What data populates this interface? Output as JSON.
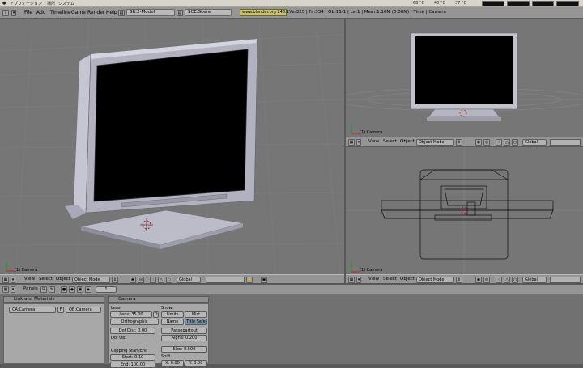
{
  "sysbar": {
    "apps": "アプリケーション",
    "places": "場所",
    "system": "システム",
    "temp1": "68 °C",
    "temp2": "40 °C",
    "temp3": "37 °C"
  },
  "header": {
    "menus": [
      "File",
      "Add",
      "Timeline",
      "Game",
      "Render",
      "Help"
    ],
    "screen": "SR:2-Model",
    "scene": "SCE:Scene",
    "url": "www.blender.org 248.1",
    "stats": "Ve:323 | Fa:334 | Ob:11-1 | La:1 | Mem:1.10M (0.06M) | Time | Camera"
  },
  "viewport": {
    "view": "View",
    "select": "Select",
    "object": "Object",
    "mode": "Object Mode",
    "orientation": "Global",
    "camera_label": "(1) Camera"
  },
  "panelbar": {
    "panels": "Panels",
    "frame": "1"
  },
  "link": {
    "title": "Link and Materials",
    "ca": "CA:Camera",
    "f": "F",
    "ob": "OB:Camera"
  },
  "camera": {
    "title": "Camera",
    "lens_head": "Lens:",
    "lens": "Lens: 35.00",
    "d": "D",
    "ortho": "Orthographic",
    "dof_dist": "Dof Dist: 0.00",
    "dof_ob": "Dof Ob:",
    "clip_head": "Clipping Start/End",
    "start": "Start: 0.10",
    "end": "End: 100.00",
    "show_head": "Show:",
    "limits": "Limits",
    "mist": "Mist",
    "name": "Name",
    "title_safe": "Title Safe",
    "passepartout": "Passepartout",
    "alpha": "Alpha: 0.200",
    "size": "Size: 0.500",
    "shift": "Shift",
    "x": "X: 0.00",
    "y": "Y: 0.00"
  },
  "colors": {
    "viewport_bg": "#767676",
    "header": "#959595",
    "selected": "#7a94a6"
  }
}
